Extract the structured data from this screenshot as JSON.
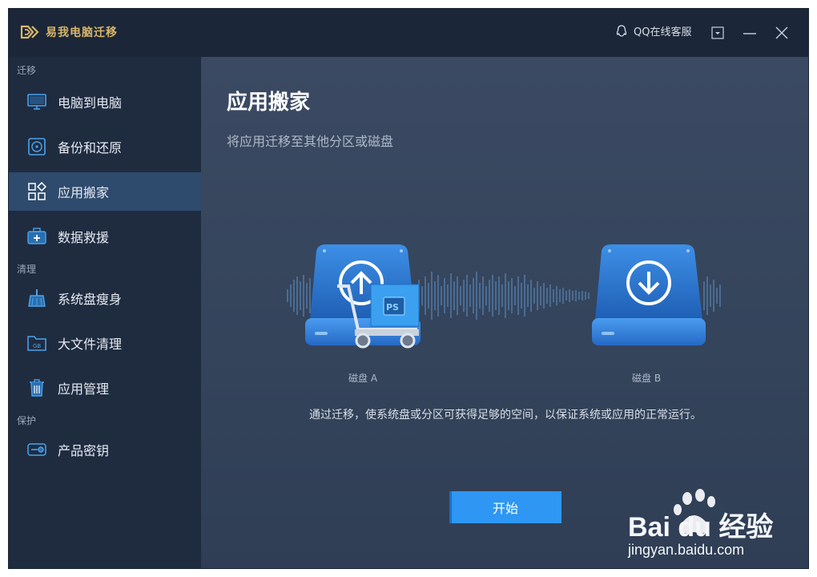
{
  "app": {
    "title": "易我电脑迁移",
    "qq_service_label": "QQ在线客服"
  },
  "sidebar": {
    "sections": [
      {
        "label": "迁移"
      },
      {
        "label": "清理"
      },
      {
        "label": "保护"
      }
    ],
    "items": [
      {
        "label": "电脑到电脑",
        "icon": "monitor-icon"
      },
      {
        "label": "备份和还原",
        "icon": "backup-icon"
      },
      {
        "label": "应用搬家",
        "icon": "apps-icon",
        "active": true
      },
      {
        "label": "数据救援",
        "icon": "rescue-kit-icon"
      },
      {
        "label": "系统盘瘦身",
        "icon": "broom-icon"
      },
      {
        "label": "大文件清理",
        "icon": "gb-folder-icon"
      },
      {
        "label": "应用管理",
        "icon": "trash-icon"
      },
      {
        "label": "产品密钥",
        "icon": "key-icon"
      }
    ]
  },
  "main": {
    "title": "应用搬家",
    "subtitle": "将应用迁移至其他分区或磁盘",
    "disk_a_label": "磁盘 A",
    "disk_b_label": "磁盘 B",
    "cart_box_label": "PS",
    "description": "通过迁移，使系统盘或分区可获得足够的空间，以保证系统或应用的正常运行。",
    "start_label": "开始"
  },
  "watermark": {
    "brand": "Bai du 经验",
    "url": "jingyan.baidu.com"
  },
  "colors": {
    "accent": "#2e96f3",
    "sidebar_bg": "#1f2c40",
    "active_item": "#2e4a6d",
    "titlebar_bg": "#1b2638",
    "brand_gold": "#d8b66a"
  }
}
